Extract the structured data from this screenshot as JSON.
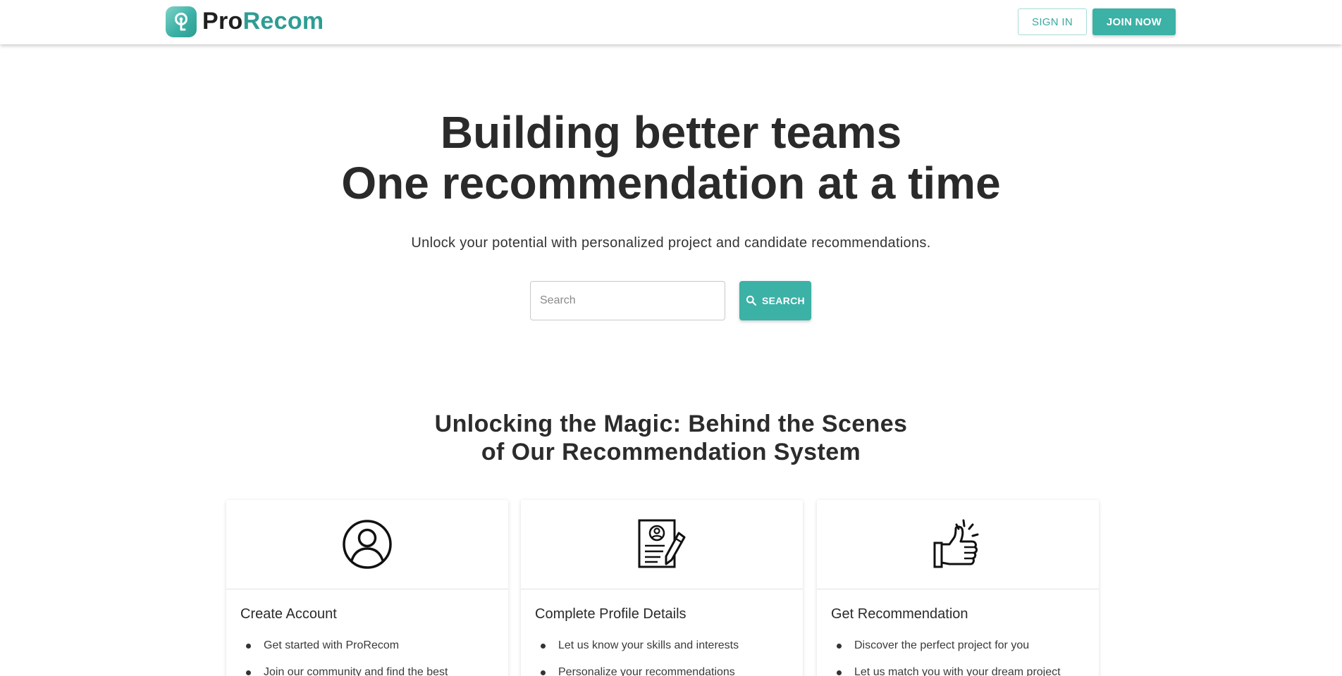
{
  "brand": {
    "pro": "Pro",
    "recom": "Recom",
    "accent": "#3cb1a6",
    "icon": "logo-p-icon"
  },
  "header": {
    "signin_label": "SIGN IN",
    "join_label": "JOIN NOW"
  },
  "hero": {
    "title_line1": "Building better teams",
    "title_line2": "One recommendation at a time",
    "subtitle": "Unlock your potential with personalized project and candidate recommendations."
  },
  "search": {
    "placeholder": "Search",
    "value": "",
    "button_label": "SEARCH",
    "icon": "search-icon"
  },
  "section": {
    "title_line1": "Unlocking the Magic: Behind the Scenes",
    "title_line2": "of Our Recommendation System"
  },
  "cards": [
    {
      "icon": "user-circle-icon",
      "title": "Create Account",
      "items": [
        "Get started with ProRecom",
        "Join our community and find the best"
      ]
    },
    {
      "icon": "resume-edit-icon",
      "title": "Complete Profile Details",
      "items": [
        "Let us know your skills and interests",
        "Personalize your recommendations"
      ]
    },
    {
      "icon": "thumbs-up-icon",
      "title": "Get Recommendation",
      "items": [
        "Discover the perfect project for you",
        "Let us match you with your dream project"
      ]
    }
  ]
}
